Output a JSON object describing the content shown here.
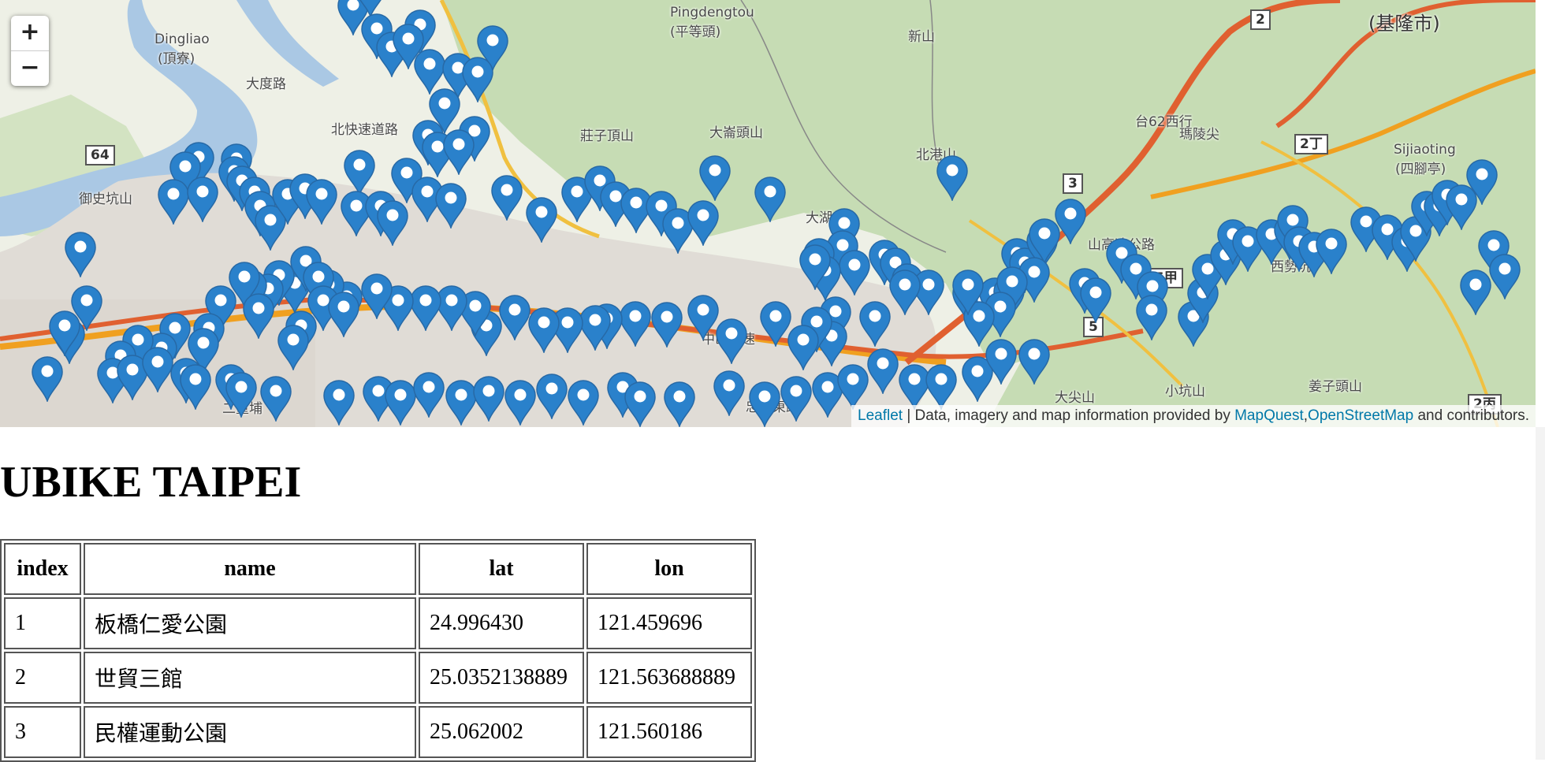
{
  "map": {
    "zoom_in": "+",
    "zoom_out": "−",
    "marker_color": "#2a81cb",
    "labels": [
      {
        "text": "Dingliao"
      },
      {
        "text": "(頂寮)"
      },
      {
        "text": "大度路"
      },
      {
        "text": "Pingdengtou"
      },
      {
        "text": "(平等頭)"
      },
      {
        "text": "新山"
      },
      {
        "text": "(基隆市)"
      },
      {
        "text": "莊子頂山"
      },
      {
        "text": "大崙頭山"
      },
      {
        "text": "北港山"
      },
      {
        "text": "御史坑山"
      },
      {
        "text": "大湖山"
      },
      {
        "text": "瑪陵尖"
      },
      {
        "text": "Sijiaoting"
      },
      {
        "text": "(四腳亭)"
      },
      {
        "text": "西勢坑"
      },
      {
        "text": "山高速公路"
      },
      {
        "text": "中山高速"
      },
      {
        "text": "忠孝東路"
      },
      {
        "text": "二重埔"
      },
      {
        "text": "大尖山"
      },
      {
        "text": "小坑山"
      },
      {
        "text": "姜子頭山"
      },
      {
        "text": "台62西行"
      },
      {
        "text": "北快速道路"
      }
    ],
    "shields": [
      "2",
      "64",
      "3",
      "2丁",
      "5甲",
      "5",
      "2丙"
    ],
    "attribution": {
      "leaflet": "Leaflet",
      "text": " | Data, imagery and map information provided by ",
      "mapquest": "MapQuest",
      "sep": ",",
      "osm": "OpenStreetMap",
      "tail": " and contributors."
    }
  },
  "page": {
    "title": "UBIKE TAIPEI"
  },
  "table": {
    "headers": [
      "index",
      "name",
      "lat",
      "lon"
    ],
    "rows": [
      [
        "1",
        "板橋仁愛公園",
        "24.996430",
        "121.459696"
      ],
      [
        "2",
        "世貿三館",
        "25.0352138889",
        "121.563688889"
      ],
      [
        "3",
        "民權運動公園",
        "25.062002",
        "121.560186"
      ]
    ]
  }
}
